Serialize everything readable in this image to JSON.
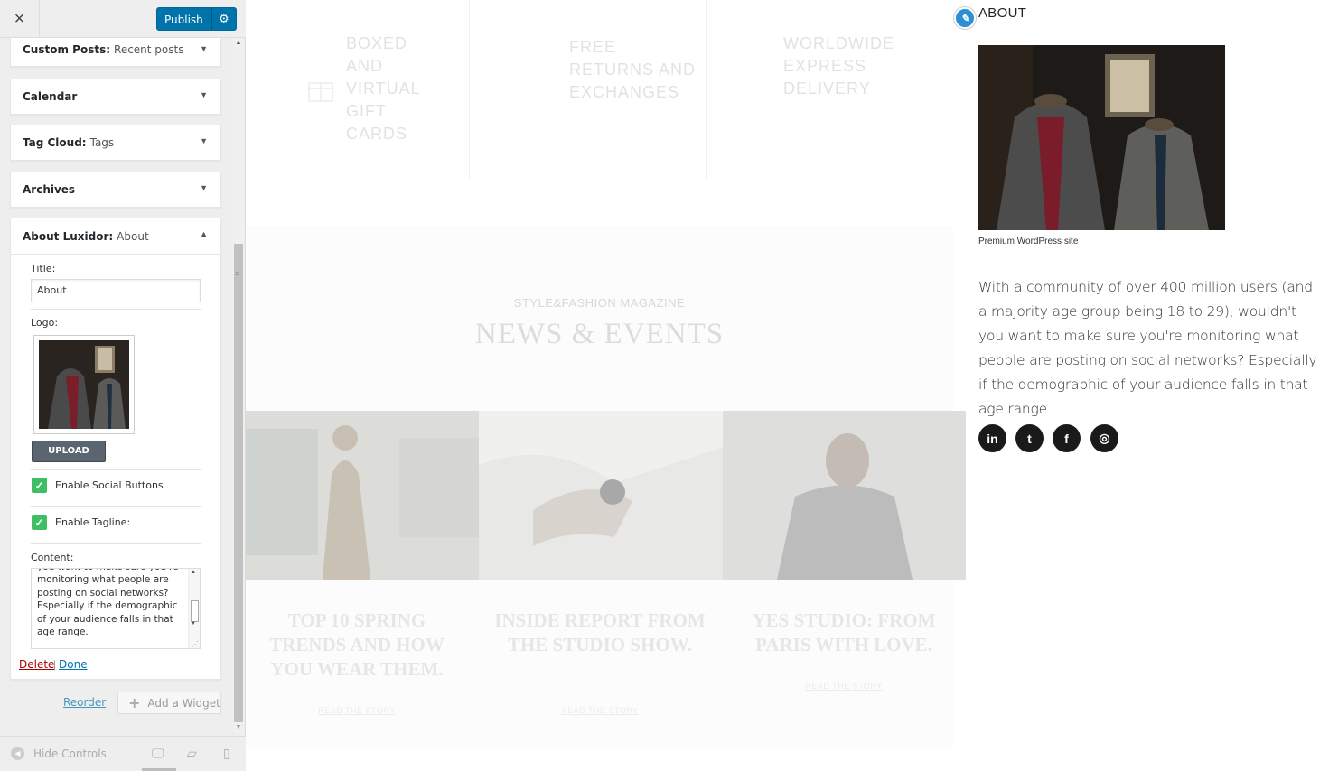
{
  "topbar": {
    "close_icon": "×",
    "publish_label": "Publish",
    "gear_icon": "⚙"
  },
  "widgets": [
    {
      "title": "Custom Posts:",
      "subtitle": "Recent posts"
    },
    {
      "title": "Calendar",
      "subtitle": ""
    },
    {
      "title": "Tag Cloud:",
      "subtitle": "Tags"
    },
    {
      "title": "Archives",
      "subtitle": ""
    }
  ],
  "about_widget": {
    "title": "About Luxidor:",
    "subtitle": "About",
    "title_label": "Title:",
    "title_value": "About",
    "logo_label": "Logo:",
    "upload_label": "UPLOAD",
    "enable_social_label": "Enable Social Buttons",
    "enable_social_checked": true,
    "enable_tagline_label": "Enable Tagline:",
    "enable_tagline_checked": true,
    "content_label": "Content:",
    "content_value": "you want to make sure you're monitoring what people are posting on social networks? Especially if the demographic of your audience falls in that age range.",
    "delete_label": "Delete",
    "separator": "|",
    "done_label": "Done"
  },
  "sidebar_footer": {
    "reorder_label": "Reorder",
    "add_widget_label": "Add a Widget",
    "hide_controls_label": "Hide Controls",
    "devices": [
      "desktop-icon",
      "tablet-icon",
      "mobile-icon"
    ]
  },
  "preview": {
    "features": [
      "BOXED AND VIRTUAL GIFT CARDS",
      "FREE RETURNS AND EXCHANGES",
      "WORLDWIDE EXPRESS DELIVERY"
    ],
    "news_kicker": "STYLE&FASHION MAGAZINE",
    "news_title": "NEWS & EVENTS",
    "news_items": [
      {
        "title": "TOP 10 SPRING TRENDS AND HOW YOU WEAR THEM.",
        "link": "READ THE STORY"
      },
      {
        "title": "INSIDE REPORT FROM THE STUDIO SHOW.",
        "link": "READ THE STORY"
      },
      {
        "title": "YES STUDIO: FROM PARIS WITH LOVE.",
        "link": "READ THE STORY"
      }
    ],
    "about": {
      "heading": "ABOUT",
      "caption": "Premium WordPress site",
      "text": "With a community of over 400 million users (and a majority age group being 18 to 29), wouldn't you want to make sure you're monitoring what people are posting on social networks? Especially if the demographic of your audience falls in that age range.",
      "social": [
        {
          "name": "linkedin-icon",
          "glyph": "in"
        },
        {
          "name": "twitter-icon",
          "glyph": "t"
        },
        {
          "name": "facebook-icon",
          "glyph": "f"
        },
        {
          "name": "instagram-icon",
          "glyph": "◎"
        }
      ]
    }
  },
  "colors": {
    "publish_blue": "#0073aa",
    "checkbox_green": "#3fbf63",
    "delete_red": "#aa0000",
    "social_dark": "#1a1a1a"
  }
}
